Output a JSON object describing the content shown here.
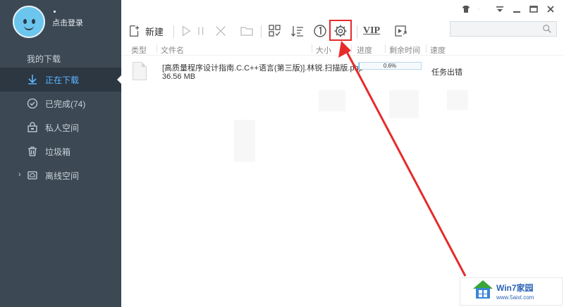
{
  "profile": {
    "login_label": "点击登录"
  },
  "sidebar": {
    "section_title": "我的下载",
    "items": [
      {
        "label": "正在下载",
        "active": true,
        "icon": "download-arrow-icon"
      },
      {
        "label": "已完成(74)",
        "active": false,
        "icon": "check-circle-icon"
      },
      {
        "label": "私人空间",
        "active": false,
        "icon": "lock-box-icon"
      },
      {
        "label": "垃圾箱",
        "active": false,
        "icon": "trash-icon"
      },
      {
        "label": "离线空间",
        "active": false,
        "icon": "cloud-folder-icon"
      }
    ]
  },
  "toolbar": {
    "new_label": "新建",
    "vip_label": "VIP",
    "icons": [
      "new-file-icon",
      "play-icon",
      "pause-icon",
      "delete-icon",
      "folder-icon",
      "select-icon",
      "sort-icon",
      "speed-limit-icon",
      "settings-gear-icon",
      "vip-icon",
      "media-play-icon",
      "search-icon"
    ]
  },
  "columns": {
    "type": "类型",
    "filename": "文件名",
    "size": "大小",
    "progress": "进度",
    "remaining": "剩余时间",
    "speed": "速度"
  },
  "downloads": [
    {
      "filename": "[高质量程序设计指南.C.C++语言(第三版)].林锐.扫描版.php",
      "size": "36.56 MB",
      "progress_text": "0.6%",
      "progress_fraction": 0.006,
      "status": "任务出错"
    }
  ],
  "watermark": {
    "title": "Win7家园",
    "url": "www.5aixt.com"
  },
  "colors": {
    "sidebar_bg": "#3c4853",
    "accent": "#5db6ff",
    "highlight": "#e62b2b"
  }
}
